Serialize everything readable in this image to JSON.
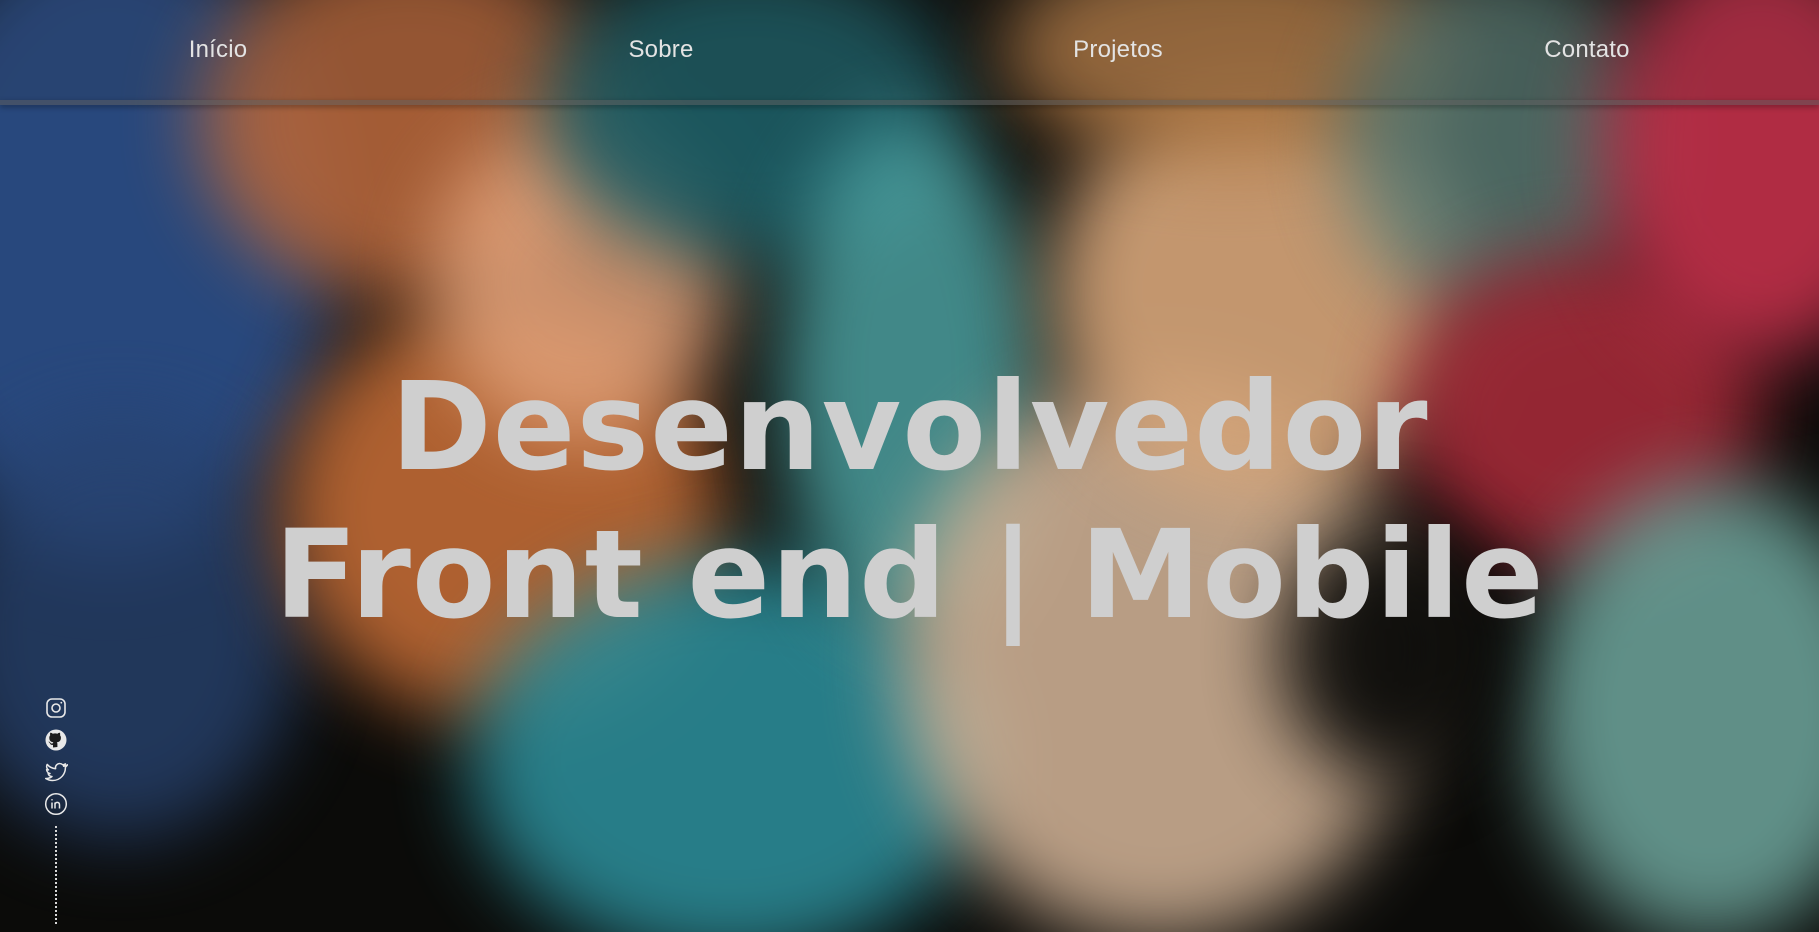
{
  "nav": {
    "items": [
      {
        "label": "Início"
      },
      {
        "label": "Sobre"
      },
      {
        "label": "Projetos"
      },
      {
        "label": "Contato"
      }
    ]
  },
  "hero": {
    "line1": "Desenvolvedor",
    "line2": "Front end | Mobile"
  },
  "social": {
    "icons": [
      "instagram-icon",
      "github-icon",
      "twitter-icon",
      "linkedin-icon"
    ]
  },
  "colors": {
    "background": "#0b0b09",
    "text": "#cfcfcf",
    "nav_text": "#e3e3e3"
  }
}
